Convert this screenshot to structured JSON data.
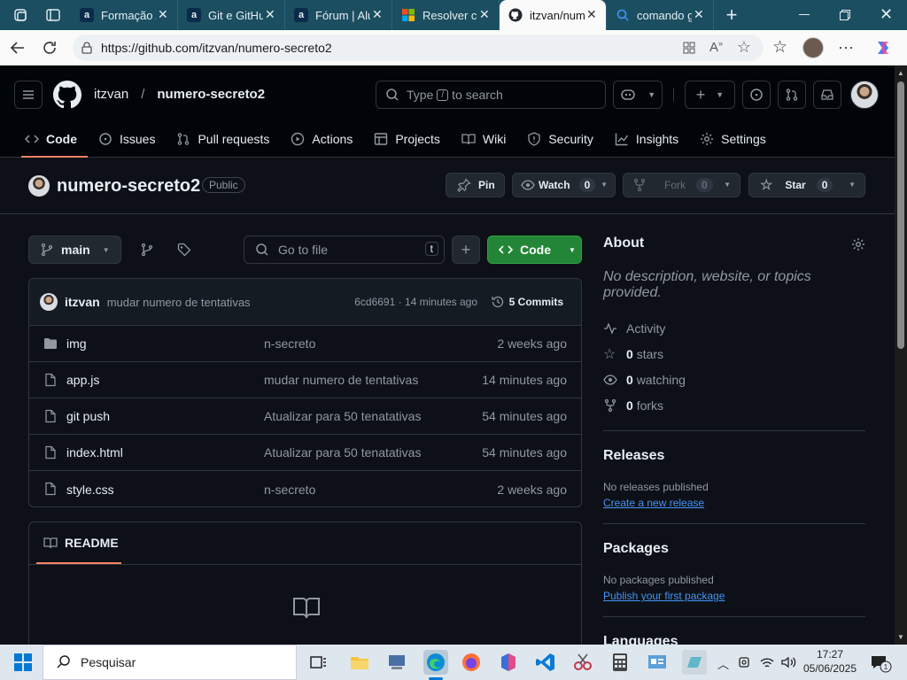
{
  "browser": {
    "tabs": [
      {
        "title": "Formação A",
        "favicon": "alura-icon",
        "active": false
      },
      {
        "title": "Git e GitHu",
        "favicon": "alura-icon",
        "active": false
      },
      {
        "title": "Fórum | Alu",
        "favicon": "alura-icon",
        "active": false
      },
      {
        "title": "Resolver co",
        "favicon": "microsoft-icon",
        "active": false
      },
      {
        "title": "itzvan/num",
        "favicon": "github-icon",
        "active": true
      },
      {
        "title": "comando g",
        "favicon": "search-icon",
        "active": false
      }
    ],
    "url": "https://github.com/itzvan/numero-secreto2"
  },
  "github": {
    "owner": "itzvan",
    "repo": "numero-secreto2",
    "search_placeholder_pre": "Type",
    "search_key": "/",
    "search_placeholder_post": "to search",
    "nav": [
      {
        "label": "Code",
        "icon": "code-icon",
        "active": true
      },
      {
        "label": "Issues",
        "icon": "issue-icon"
      },
      {
        "label": "Pull requests",
        "icon": "pull-request-icon"
      },
      {
        "label": "Actions",
        "icon": "play-icon"
      },
      {
        "label": "Projects",
        "icon": "table-icon"
      },
      {
        "label": "Wiki",
        "icon": "book-icon"
      },
      {
        "label": "Security",
        "icon": "shield-icon"
      },
      {
        "label": "Insights",
        "icon": "graph-icon"
      },
      {
        "label": "Settings",
        "icon": "gear-icon"
      }
    ],
    "visibility": "Public",
    "pin_label": "Pin",
    "watch_label": "Watch",
    "watch_count": "0",
    "fork_label": "Fork",
    "fork_count": "0",
    "star_label": "Star",
    "star_count": "0"
  },
  "code": {
    "branch": "main",
    "goto_placeholder": "Go to file",
    "goto_key": "t",
    "code_button": "Code",
    "commit": {
      "author": "itzvan",
      "message": "mudar numero de tentativas",
      "hash_time": "6cd6691 · 14 minutes ago",
      "commits_label": "5 Commits"
    },
    "files": [
      {
        "name": "img",
        "type": "folder",
        "message": "n-secreto",
        "date": "2 weeks ago"
      },
      {
        "name": "app.js",
        "type": "file",
        "message": "mudar numero de tentativas",
        "date": "14 minutes ago"
      },
      {
        "name": "git push",
        "type": "file",
        "message": "Atualizar para 50 tenatativas",
        "date": "54 minutes ago"
      },
      {
        "name": "index.html",
        "type": "file",
        "message": "Atualizar para 50 tenatativas",
        "date": "54 minutes ago"
      },
      {
        "name": "style.css",
        "type": "file",
        "message": "n-secreto",
        "date": "2 weeks ago"
      }
    ],
    "readme_label": "README"
  },
  "about": {
    "title": "About",
    "description": "No description, website, or topics provided.",
    "activity": "Activity",
    "stars_count": "0",
    "stars_label": "stars",
    "watching_count": "0",
    "watching_label": "watching",
    "forks_count": "0",
    "forks_label": "forks",
    "releases_title": "Releases",
    "releases_text": "No releases published",
    "releases_link": "Create a new release",
    "packages_title": "Packages",
    "packages_text": "No packages published",
    "packages_link": "Publish your first package",
    "languages_title": "Languages"
  },
  "taskbar": {
    "search_label": "Pesquisar",
    "time": "17:27",
    "date": "05/06/2025"
  },
  "colors": {
    "accent_green": "#238636",
    "link_blue": "#4493f8",
    "tab_underline": "#f78166",
    "edge_tabbar": "#1c4e61"
  }
}
